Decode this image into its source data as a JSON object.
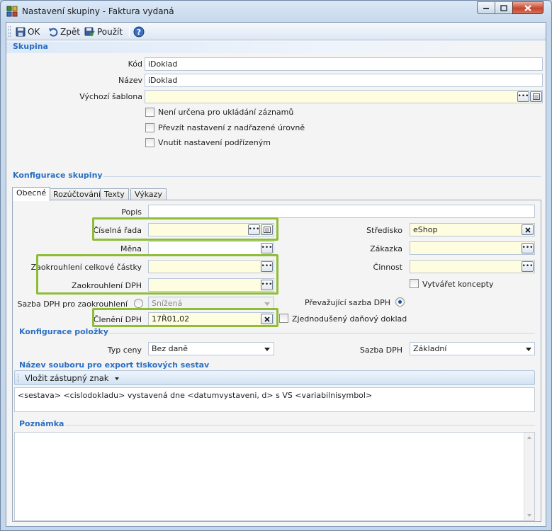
{
  "window": {
    "title": "Nastavení skupiny - Faktura vydaná"
  },
  "toolbar": {
    "ok_label": "OK",
    "back_label": "Zpět",
    "use_label": "Použít"
  },
  "skupina": {
    "header": "Skupina",
    "kod_label": "Kód",
    "kod_value": "iDoklad",
    "nazev_label": "Název",
    "nazev_value": "iDoklad",
    "sablona_label": "Výchozí šablona",
    "sablona_value": "",
    "chk_neni_urcena": "Není určena pro ukládání záznamů",
    "chk_prevzit": "Převzít nastavení z nadřazené úrovně",
    "chk_vnutit": "Vnutit nastavení podřízeným"
  },
  "konfigurace": {
    "header": "Konfigurace skupiny",
    "tabs": [
      "Obecné",
      "Rozúčtování",
      "Texty",
      "Výkazy"
    ]
  },
  "obecne": {
    "popis_label": "Popis",
    "popis_value": "",
    "ciselna_rada_label": "Číselná řada",
    "ciselna_rada_value": "",
    "mena_label": "Měna",
    "mena_value": "",
    "zaokr_celk_label": "Zaokrouhlení celkové částky",
    "zaokr_celk_value": "",
    "zaokr_dph_label": "Zaokrouhlení DPH",
    "zaokr_dph_value": "",
    "sazba_zaokr_label": "Sazba DPH pro zaokrouhlení",
    "sazba_zaokr_value": "Snížená",
    "cleneni_label": "Členění DPH",
    "cleneni_value": "17Ř01,02",
    "stredisko_label": "Středisko",
    "stredisko_value": "eShop",
    "zakazka_label": "Zákazka",
    "zakazka_value": "",
    "cinnost_label": "Činnost",
    "cinnost_value": "",
    "vytvaret_koncepty": "Vytvářet koncepty",
    "prevazujici_label": "Převažující sazba DPH",
    "zjednoduseny": "Zjednodušený daňový doklad"
  },
  "polozky": {
    "header": "Konfigurace položky",
    "typ_ceny_label": "Typ ceny",
    "typ_ceny_value": "Bez daně",
    "sazba_label": "Sazba DPH",
    "sazba_value": "Základní"
  },
  "export": {
    "header": "Název souboru pro export tiskových sestav",
    "insert_label": "Vložit zástupný znak",
    "template_value": "<sestava> <cislodokladu> vystavená dne <datumvystaveni, d> s VS <variabilnisymbol>"
  },
  "poznamka": {
    "header": "Poznámka",
    "value": ""
  },
  "colors": {
    "accent": "#2a6fc2",
    "highlight": "#8fbd38",
    "required_field": "#fffde0"
  }
}
